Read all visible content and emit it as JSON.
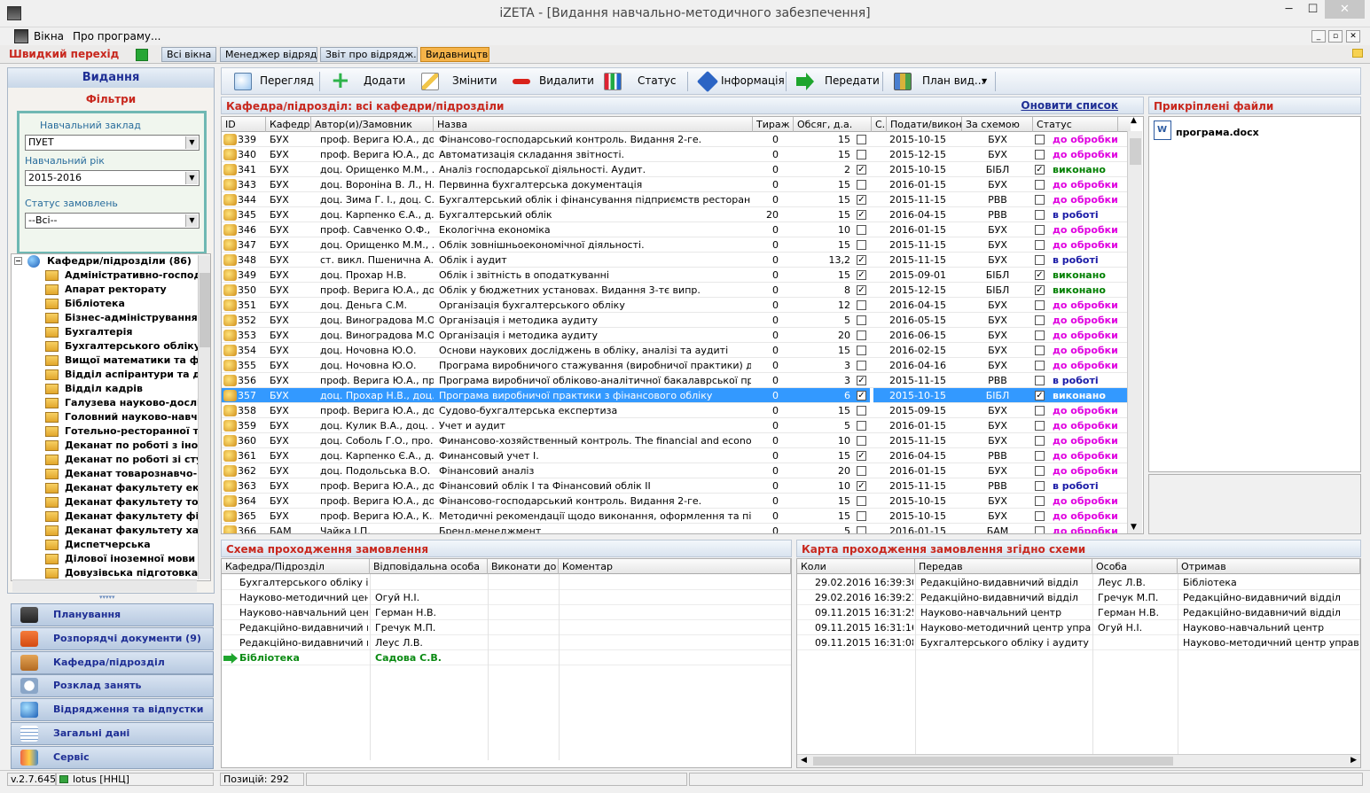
{
  "window": {
    "title": "iZETA - [Видання навчально-методичного забезпечення]",
    "min": "─",
    "max": "☐",
    "close": "✕"
  },
  "menu": {
    "windows": "Вікна",
    "about": "Про програму..."
  },
  "quick": {
    "label": "Швидкий перехід",
    "tabs": [
      "Всі вікна",
      "Менеджер відряд...",
      "Звіт про відрядж...",
      "Видавництво"
    ]
  },
  "left": {
    "title": "Видання",
    "filters_title": "Фільтри",
    "institution_label": "Навчальний заклад",
    "institution_value": "ПУЕТ",
    "year_label": "Навчальний рік",
    "year_value": "2015-2016",
    "status_label": "Статус замовлень",
    "status_value": "--Всі--",
    "tree_root": "Кафедри/підрозділи (86)",
    "tree_items": [
      "Адміністративно-господа",
      "Апарат ректорату",
      "Бібліотека",
      "Бізнес-адміністрування т",
      "Бухгалтерія",
      "Бухгалтерського обліку і",
      "Вищої математики та фіз",
      "Відділ аспірантури та док",
      "Відділ кадрів",
      "Галузева науково-дослід",
      "Головний науково-навчал",
      "Готельно-ресторанної та",
      "Деканат по роботі з іноз",
      "Деканат по роботі зі сту",
      "Деканат товарознавчо-к",
      "Деканат факультету еко",
      "Деканат факультету тов",
      "Деканат факультету фіна",
      "Деканат факультету хар",
      "Диспетчерська",
      "Ділової іноземної мови",
      "Довузівська підготовка"
    ],
    "nav": [
      "Планування",
      "Розпорядчі документи (9)",
      "Кафедра/підрозділ",
      "Розклад занять",
      "Відрядження та відпустки",
      "Загальні дані",
      "Сервіс"
    ]
  },
  "toolbar": {
    "view": "Перегляд",
    "add": "Додати",
    "edit": "Змінити",
    "delete": "Видалити",
    "status": "Статус",
    "info": "Інформація",
    "send": "Передати",
    "plan": "План вид..."
  },
  "grid": {
    "title": "Кафедра/підрозділ:  всі кафедри/підрозділи",
    "refresh": "Оновити список",
    "columns": [
      "ID",
      "Кафедра",
      "Автор(и)/Замовник",
      "Назва",
      "Тираж",
      "Обсяг, д.а.",
      "С.",
      "Подати/виконати",
      "За схемою",
      "Статус"
    ],
    "rows": [
      [
        "339",
        "БУХ",
        "проф. Верига Ю.А., до...",
        "Фінансово-господарський контроль. Видання 2-ге.",
        "0",
        "15",
        "",
        "2015-10-15",
        "БУХ",
        "",
        "до обробки"
      ],
      [
        "340",
        "БУХ",
        "проф. Верига Ю.А., до...",
        "Автоматизація складання звітності.",
        "0",
        "15",
        "",
        "2015-12-15",
        "БУХ",
        "",
        "до обробки"
      ],
      [
        "341",
        "БУХ",
        "доц. Орищенко М.М., ...",
        "Аналіз господарської діяльності. Аудит.",
        "0",
        "2",
        "✓",
        "2015-10-15",
        "БІБЛ",
        "✓",
        "виконано"
      ],
      [
        "343",
        "БУХ",
        "доц. Вороніна В. Л., Н...",
        "Первинна бухгалтерська документація",
        "0",
        "15",
        "",
        "2016-01-15",
        "БУХ",
        "",
        "до обробки"
      ],
      [
        "344",
        "БУХ",
        "доц. Зима Г. І., доц. С...",
        "Бухгалтерський облік і фінансування підприємств ресторанного го...",
        "0",
        "15",
        "✓",
        "2015-11-15",
        "РВВ",
        "",
        "до обробки"
      ],
      [
        "345",
        "БУХ",
        "доц. Карпенко Є.А., д...",
        "Бухгалтерський облік",
        "20",
        "15",
        "✓",
        "2016-04-15",
        "РВВ",
        "",
        "в роботі"
      ],
      [
        "346",
        "БУХ",
        "проф. Савченко О.Ф., ...",
        "Екологічна економіка",
        "0",
        "10",
        "",
        "2016-01-15",
        "БУХ",
        "",
        "до обробки"
      ],
      [
        "347",
        "БУХ",
        "доц. Орищенко М.М., ...",
        "Облік зовнішньоекономічної діяльності.",
        "0",
        "15",
        "",
        "2015-11-15",
        "БУХ",
        "",
        "до обробки"
      ],
      [
        "348",
        "БУХ",
        "ст. викл. Пшенична А...",
        "Облік і аудит",
        "0",
        "13,2",
        "✓",
        "2015-11-15",
        "БУХ",
        "",
        "в роботі"
      ],
      [
        "349",
        "БУХ",
        "доц. Прохар Н.В.",
        "Облік і звітність в оподаткуванні",
        "0",
        "15",
        "✓",
        "2015-09-01",
        "БІБЛ",
        "✓",
        "виконано"
      ],
      [
        "350",
        "БУХ",
        "проф. Верига Ю.А., до...",
        "Облік у бюджетних установах. Видання 3-тє випр.",
        "0",
        "8",
        "✓",
        "2015-12-15",
        "БІБЛ",
        "✓",
        "виконано"
      ],
      [
        "351",
        "БУХ",
        "доц. Деньга С.М.",
        "Організація бухгалтерського обліку",
        "0",
        "12",
        "",
        "2016-04-15",
        "БУХ",
        "",
        "до обробки"
      ],
      [
        "352",
        "БУХ",
        "доц. Виноградова М.О.",
        "Організація і методика аудиту",
        "0",
        "5",
        "",
        "2016-05-15",
        "БУХ",
        "",
        "до обробки"
      ],
      [
        "353",
        "БУХ",
        "доц. Виноградова М.О.",
        "Організація і методика аудиту",
        "0",
        "20",
        "",
        "2016-06-15",
        "БУХ",
        "",
        "до обробки"
      ],
      [
        "354",
        "БУХ",
        "доц. Ночовна Ю.О.",
        "Основи наукових досліджень в обліку, аналізі та аудиті",
        "0",
        "15",
        "",
        "2016-02-15",
        "БУХ",
        "",
        "до обробки"
      ],
      [
        "355",
        "БУХ",
        "доц. Ночовна Ю.О.",
        "Програма виробничого стажування (виробничої практики) для сту...",
        "0",
        "3",
        "",
        "2016-04-16",
        "БУХ",
        "",
        "до обробки"
      ],
      [
        "356",
        "БУХ",
        "проф. Верига Ю.А., пр...",
        "Програма виробничої обліково-аналітичної бакалаврської практик...",
        "0",
        "3",
        "✓",
        "2015-11-15",
        "РВВ",
        "",
        "в роботі"
      ],
      [
        "357",
        "БУХ",
        "доц. Прохар Н.В., доц....",
        "Програма виробничої практики з фінансового обліку",
        "0",
        "6",
        "✓",
        "2015-10-15",
        "БІБЛ",
        "✓",
        "виконано"
      ],
      [
        "358",
        "БУХ",
        "проф. Верига Ю.А., до...",
        "Судово-бухгалтерська експертиза",
        "0",
        "15",
        "",
        "2015-09-15",
        "БУХ",
        "",
        "до обробки"
      ],
      [
        "359",
        "БУХ",
        "доц. Кулик В.А., доц. ...",
        "Учет и аудит",
        "0",
        "5",
        "",
        "2016-01-15",
        "БУХ",
        "",
        "до обробки"
      ],
      [
        "360",
        "БУХ",
        "доц. Соболь Г.О., про...",
        "Финансово-хозяйственный контроль. The financial and economic c...",
        "0",
        "10",
        "",
        "2015-11-15",
        "БУХ",
        "",
        "до обробки"
      ],
      [
        "361",
        "БУХ",
        "доц. Карпенко Є.А., д...",
        "Финансовый учет І.",
        "0",
        "15",
        "✓",
        "2016-04-15",
        "РВВ",
        "",
        "до обробки"
      ],
      [
        "362",
        "БУХ",
        "доц. Подольська В.О.",
        "Фінансовий аналіз",
        "0",
        "20",
        "",
        "2016-01-15",
        "БУХ",
        "",
        "до обробки"
      ],
      [
        "363",
        "БУХ",
        "проф. Верига Ю.А., до...",
        "Фінансовий облік І та Фінансовий облік ІІ",
        "0",
        "10",
        "✓",
        "2015-11-15",
        "РВВ",
        "",
        "в роботі"
      ],
      [
        "364",
        "БУХ",
        "проф. Верига Ю.А., до...",
        "Фінансово-господарський контроль. Видання 2-ге.",
        "0",
        "15",
        "",
        "2015-10-15",
        "БУХ",
        "",
        "до обробки"
      ],
      [
        "365",
        "БУХ",
        "проф. Верига Ю.А., К...",
        "Методичні рекомендації щодо виконання, оформлення та підготов...",
        "0",
        "15",
        "",
        "2015-10-15",
        "БУХ",
        "",
        "до обробки"
      ],
      [
        "366",
        "БАМ",
        "Чайка І.П.",
        "Бренд-менеджмент",
        "0",
        "5",
        "",
        "2016-01-15",
        "БАМ",
        "",
        "до обробки"
      ]
    ],
    "selected": "357"
  },
  "files": {
    "title": "Прикріплені файли",
    "items": [
      "програма.docx"
    ]
  },
  "scheme": {
    "title": "Схема проходження замовлення",
    "columns": [
      "Кафедра/Підрозділ",
      "Відповідальна особа",
      "Виконати до",
      "Коментар"
    ],
    "rows": [
      [
        "Бухгалтерського обліку і а...",
        "",
        "",
        ""
      ],
      [
        "Науково-методичний цент...",
        "Огуй Н.І.",
        "",
        ""
      ],
      [
        "Науково-навчальний центр",
        "Герман Н.В.",
        "",
        ""
      ],
      [
        "Редакційно-видавничий від...",
        "Гречук М.П.",
        "",
        ""
      ],
      [
        "Редакційно-видавничий від...",
        "Леус Л.В.",
        "",
        ""
      ],
      [
        "Бібліотека",
        "Садова С.В.",
        "",
        ""
      ]
    ],
    "current_row": 5
  },
  "card": {
    "title": "Карта проходження замовлення згідно схеми",
    "columns": [
      "Коли",
      "Передав",
      "Особа",
      "Отримав"
    ],
    "rows": [
      [
        "29.02.2016 16:39:30",
        "Редакційно-видавничий відділ",
        "Леус Л.В.",
        "Бібліотека"
      ],
      [
        "29.02.2016 16:39:21",
        "Редакційно-видавничий відділ",
        "Гречук М.П.",
        "Редакційно-видавничий відділ"
      ],
      [
        "09.11.2015 16:31:25",
        "Науково-навчальний центр",
        "Герман Н.В.",
        "Редакційно-видавничий відділ"
      ],
      [
        "09.11.2015 16:31:16",
        "Науково-методичний центр управлі...",
        "Огуй Н.І.",
        "Науково-навчальний центр"
      ],
      [
        "09.11.2015 16:31:08",
        "Бухгалтерського обліку і аудиту",
        "",
        "Науково-методичний центр управлі..."
      ]
    ]
  },
  "status": {
    "version": "v.2.7.645",
    "server": "lotus [ННЦ]",
    "positions": "Позицій: 292"
  },
  "colors": {
    "todo": "#e000e0",
    "done": "#008000",
    "inwork": "#1a1aa6",
    "accent_red": "#c8281e",
    "nav_blue": "#1f2f95"
  }
}
